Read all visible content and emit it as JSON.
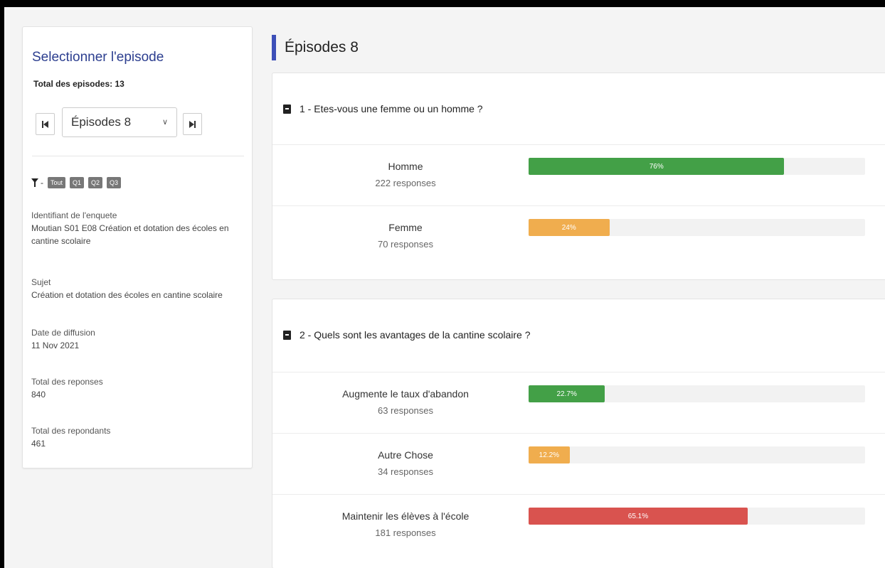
{
  "sidebar": {
    "title": "Selectionner l'episode",
    "total_episodes": "Total des episodes: 13",
    "nav_prev_icon": "first-page-icon",
    "nav_next_icon": "last-page-icon",
    "episode_select": {
      "value": "Épisodes 8"
    },
    "filter": {
      "icon": "filter-icon",
      "dash": "-",
      "tags": [
        "Tout",
        "Q1",
        "Q2",
        "Q3"
      ]
    },
    "fields": [
      {
        "label": "Identifiant de l'enquete",
        "value": "Moutian S01 E08 Création et dotation des écoles en cantine scolaire"
      },
      {
        "label": "Sujet",
        "value": "Création et dotation des écoles en cantine scolaire"
      },
      {
        "label": "Date de diffusion",
        "value": "11 Nov 2021"
      },
      {
        "label": "Total des reponses",
        "value": "840"
      },
      {
        "label": "Total des repondants",
        "value": "461"
      }
    ]
  },
  "main": {
    "title": "Épisodes 8",
    "accent_color": "#3d4fb8",
    "questions": [
      {
        "text": "1 - Etes-vous une femme ou un homme ?",
        "answers": [
          {
            "label": "Homme",
            "count": "222 responses",
            "percent_label": "76%",
            "fraction": 0.76,
            "color": "#43a047"
          },
          {
            "label": "Femme",
            "count": "70 responses",
            "percent_label": "24%",
            "fraction": 0.24,
            "color": "#f0ad4e"
          }
        ]
      },
      {
        "text": "2 - Quels sont les avantages de la cantine scolaire ?",
        "answers": [
          {
            "label": "Augmente le taux d'abandon",
            "count": "63 responses",
            "percent_label": "22.7%",
            "fraction": 0.227,
            "color": "#43a047"
          },
          {
            "label": "Autre Chose",
            "count": "34 responses",
            "percent_label": "12.2%",
            "fraction": 0.122,
            "color": "#f0ad4e"
          },
          {
            "label": "Maintenir les élèves à l'école",
            "count": "181 responses",
            "percent_label": "65.1%",
            "fraction": 0.651,
            "color": "#d9534f"
          }
        ]
      }
    ]
  }
}
